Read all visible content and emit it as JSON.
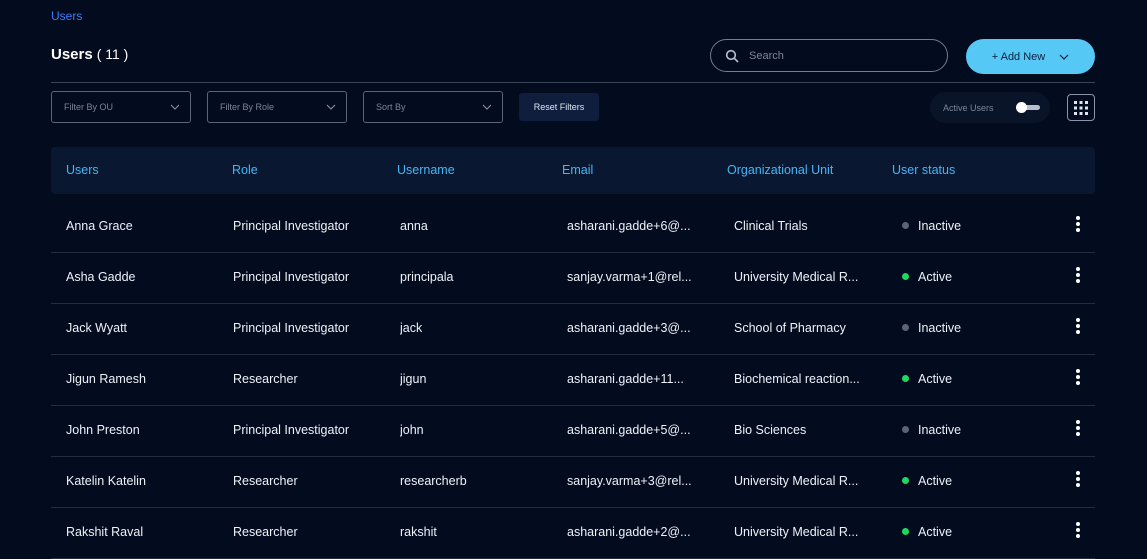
{
  "breadcrumb": "Users",
  "page": {
    "title": "Users",
    "count": "( 11 )"
  },
  "search": {
    "placeholder": "Search",
    "value": ""
  },
  "add_button": {
    "label": "+ Add New"
  },
  "filters": {
    "ou": "Filter By OU",
    "role": "Filter By Role",
    "sort": "Sort By",
    "reset": "Reset Filters",
    "active_users_label": "Active Users"
  },
  "table": {
    "headers": [
      "Users",
      "Role",
      "Username",
      "Email",
      "Organizational Unit",
      "User status"
    ],
    "rows": [
      {
        "name": "Anna Grace",
        "role": "Principal Investigator",
        "username": "anna",
        "email": "asharani.gadde+6@...",
        "ou": "Clinical Trials",
        "status": "Inactive"
      },
      {
        "name": "Asha Gadde",
        "role": "Principal Investigator",
        "username": "principala",
        "email": "sanjay.varma+1@rel...",
        "ou": "University Medical R...",
        "status": "Active"
      },
      {
        "name": "Jack Wyatt",
        "role": "Principal Investigator",
        "username": "jack",
        "email": "asharani.gadde+3@...",
        "ou": "School of Pharmacy",
        "status": "Inactive"
      },
      {
        "name": "Jigun Ramesh",
        "role": "Researcher",
        "username": "jigun",
        "email": "asharani.gadde+11...",
        "ou": "Biochemical reaction...",
        "status": "Active"
      },
      {
        "name": "John Preston",
        "role": "Principal Investigator",
        "username": "john",
        "email": "asharani.gadde+5@...",
        "ou": "Bio Sciences",
        "status": "Inactive"
      },
      {
        "name": "Katelin Katelin",
        "role": "Researcher",
        "username": "researcherb",
        "email": "sanjay.varma+3@rel...",
        "ou": "University Medical R...",
        "status": "Active"
      },
      {
        "name": "Rakshit Raval",
        "role": "Researcher",
        "username": "rakshit",
        "email": "asharani.gadde+2@...",
        "ou": "University Medical R...",
        "status": "Active"
      }
    ]
  },
  "colors": {
    "active": "#1ed760",
    "inactive": "#5a6478",
    "accent": "#56c8f5",
    "header_text": "#45b5f5"
  }
}
